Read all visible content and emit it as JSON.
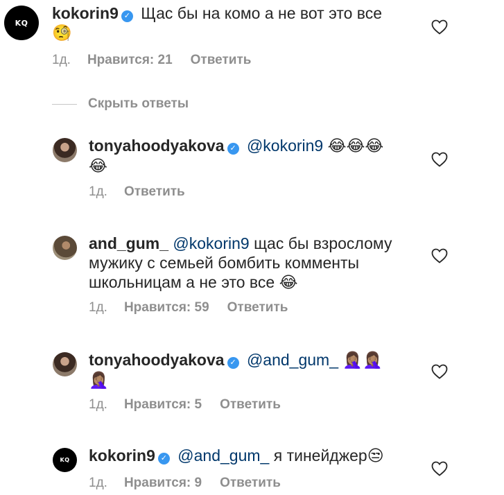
{
  "comments": [
    {
      "username": "kokorin9",
      "text": "Щас бы на комо а не вот это все",
      "emoji": "🧐",
      "time": "1д.",
      "likes": "Нравится: 21",
      "reply": "Ответить",
      "avatar_text": "KQ"
    },
    {
      "username": "tonyahoodyakova",
      "mention": "@kokorin9",
      "text": "",
      "emoji": "😂😂😂",
      "emoji2": "😂",
      "time": "1д.",
      "reply": "Ответить"
    },
    {
      "username": "and_gum_",
      "mention": "@kokorin9",
      "text": "щас бы взрослому мужику с семьей бомбить комменты школьницам а не это все",
      "emoji": "😂",
      "time": "1д.",
      "likes": "Нравится: 59",
      "reply": "Ответить"
    },
    {
      "username": "tonyahoodyakova",
      "mention": "@and_gum_",
      "emoji": "🤦🏽‍♀️🤦🏽‍♀️",
      "emoji2": "🤦🏽‍♀️",
      "time": "1д.",
      "likes": "Нравится: 5",
      "reply": "Ответить"
    },
    {
      "username": "kokorin9",
      "mention": "@and_gum_",
      "text": "я тинейджер",
      "emoji": "😒",
      "time": "1д.",
      "likes": "Нравится: 9",
      "reply": "Ответить",
      "avatar_text": "KQ"
    }
  ],
  "hide_replies": "Скрыть ответы",
  "verified_icon": "✓",
  "colors": {
    "mention": "#00376b",
    "meta": "#8e8e8e",
    "verified": "#3897f0"
  },
  "icons": {
    "like": "heart-outline-icon",
    "verified": "verified-badge-icon"
  }
}
